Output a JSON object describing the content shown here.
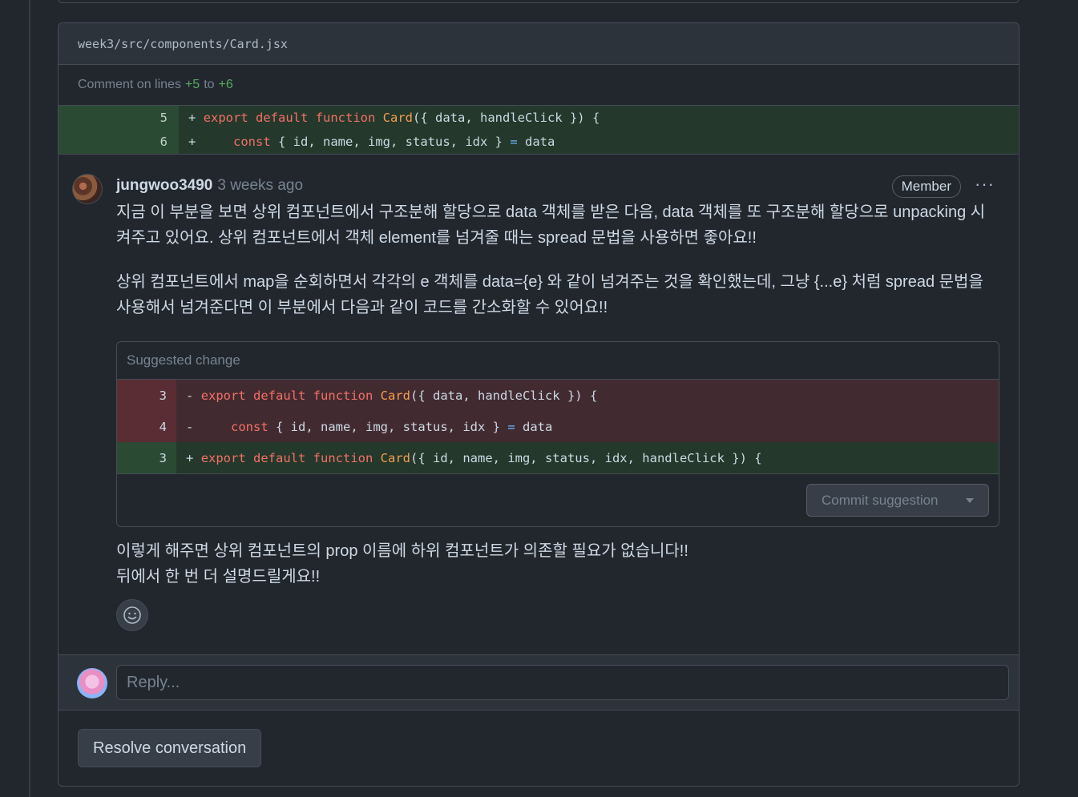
{
  "file": {
    "path": "week3/src/components/Card.jsx"
  },
  "comment_lines": {
    "prefix": "Comment on lines",
    "start": "+5",
    "to": "to",
    "end": "+6"
  },
  "diff": {
    "rows": [
      {
        "num": "5",
        "sign": "+",
        "kw1": "export default function",
        "fn": "Card",
        "rest": "({ data, handleClick }) {"
      },
      {
        "num": "6",
        "sign": "+",
        "indent": "    ",
        "kw1": "const",
        "rest": " { id, name, img, status, idx } ",
        "op": "=",
        "rest2": " data"
      }
    ]
  },
  "comment": {
    "author": "jungwoo3490",
    "time": "3 weeks ago",
    "badge": "Member",
    "more": "···",
    "paragraphs": [
      "지금 이 부분을 보면 상위 컴포넌트에서 구조분해 할당으로 data 객체를 받은 다음, data 객체를 또 구조분해 할당으로 unpacking 시켜주고 있어요. 상위 컴포넌트에서 객체 element를 넘겨줄 때는 spread 문법을 사용하면 좋아요!!",
      "상위 컴포넌트에서 map을 순회하면서 각각의 e 객체를 data={e} 와 같이 넘겨주는 것을 확인했는데, 그냥 {...e} 처럼 spread 문법을 사용해서 넘겨준다면 이 부분에서 다음과 같이 코드를 간소화할 수 있어요!!"
    ],
    "after": [
      "이렇게 해주면 상위 컴포넌트의 prop 이름에 하위 컴포넌트가 의존할 필요가 없습니다!!",
      "뒤에서 한 번 더 설명드릴게요!!"
    ]
  },
  "suggestion": {
    "title": "Suggested change",
    "rows": [
      {
        "type": "del",
        "num": "3",
        "sign": "-",
        "indent": "",
        "kw1": "export default function",
        "fn": "Card",
        "rest": "({ data, handleClick }) {"
      },
      {
        "type": "del",
        "num": "4",
        "sign": "-",
        "indent": "    ",
        "kw1": "const",
        "rest": " { id, name, img, status, idx } ",
        "op": "=",
        "rest2": " data"
      },
      {
        "type": "add",
        "num": "3",
        "sign": "+",
        "indent": "",
        "kw1": "export default function",
        "fn": "Card",
        "rest": "({ id, name, img, status, idx, handleClick }) {"
      }
    ],
    "commit_label": "Commit suggestion"
  },
  "reply": {
    "placeholder": "Reply..."
  },
  "resolve": {
    "label": "Resolve conversation"
  },
  "colors": {
    "bg": "#22272e",
    "add": "#24382b",
    "del": "#422b30",
    "keyword": "#f47067",
    "function": "#f69d50"
  }
}
